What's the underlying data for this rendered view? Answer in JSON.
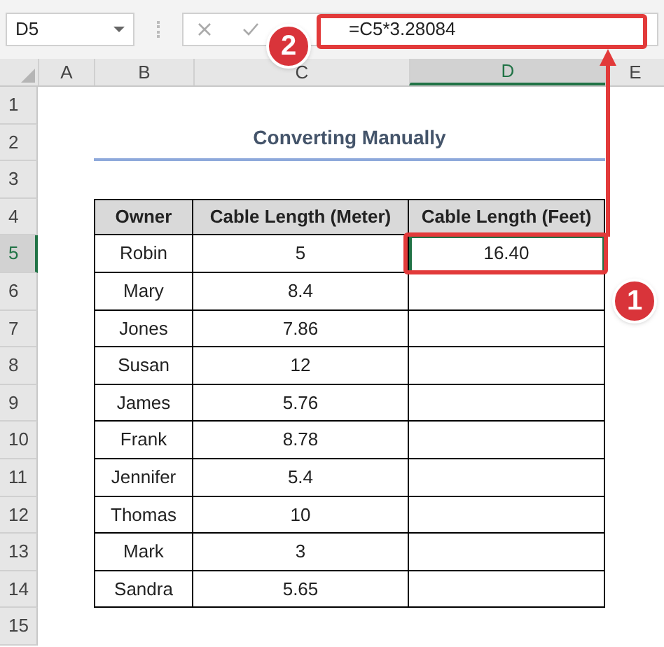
{
  "name_box": "D5",
  "formula": "=C5*3.28084",
  "column_headers": [
    {
      "label": "A",
      "selected": false
    },
    {
      "label": "B",
      "selected": false
    },
    {
      "label": "C",
      "selected": false
    },
    {
      "label": "D",
      "selected": true
    },
    {
      "label": "E",
      "selected": false
    }
  ],
  "row_headers": [
    {
      "label": "1",
      "selected": false
    },
    {
      "label": "2",
      "selected": false
    },
    {
      "label": "3",
      "selected": false
    },
    {
      "label": "4",
      "selected": false
    },
    {
      "label": "5",
      "selected": true
    },
    {
      "label": "6",
      "selected": false
    },
    {
      "label": "7",
      "selected": false
    },
    {
      "label": "8",
      "selected": false
    },
    {
      "label": "9",
      "selected": false
    },
    {
      "label": "10",
      "selected": false
    },
    {
      "label": "11",
      "selected": false
    },
    {
      "label": "12",
      "selected": false
    },
    {
      "label": "13",
      "selected": false
    },
    {
      "label": "14",
      "selected": false
    },
    {
      "label": "15",
      "selected": false
    }
  ],
  "title": "Converting Manually",
  "table": {
    "columns": [
      "Owner",
      "Cable Length (Meter)",
      "Cable Length (Feet)"
    ],
    "rows": [
      {
        "cells": [
          "Robin",
          "5",
          "16.40"
        ],
        "feet_cell_selected": true
      },
      {
        "cells": [
          "Mary",
          "8.4",
          ""
        ],
        "feet_cell_selected": false
      },
      {
        "cells": [
          "Jones",
          "7.86",
          ""
        ],
        "feet_cell_selected": false
      },
      {
        "cells": [
          "Susan",
          "12",
          ""
        ],
        "feet_cell_selected": false
      },
      {
        "cells": [
          "James",
          "5.76",
          ""
        ],
        "feet_cell_selected": false
      },
      {
        "cells": [
          "Frank",
          "8.78",
          ""
        ],
        "feet_cell_selected": false
      },
      {
        "cells": [
          "Jennifer",
          "5.4",
          ""
        ],
        "feet_cell_selected": false
      },
      {
        "cells": [
          "Thomas",
          "10",
          ""
        ],
        "feet_cell_selected": false
      },
      {
        "cells": [
          "Mark",
          "3",
          ""
        ],
        "feet_cell_selected": false
      },
      {
        "cells": [
          "Sandra",
          "5.65",
          ""
        ],
        "feet_cell_selected": false
      }
    ]
  },
  "callouts": [
    "1",
    "2"
  ]
}
